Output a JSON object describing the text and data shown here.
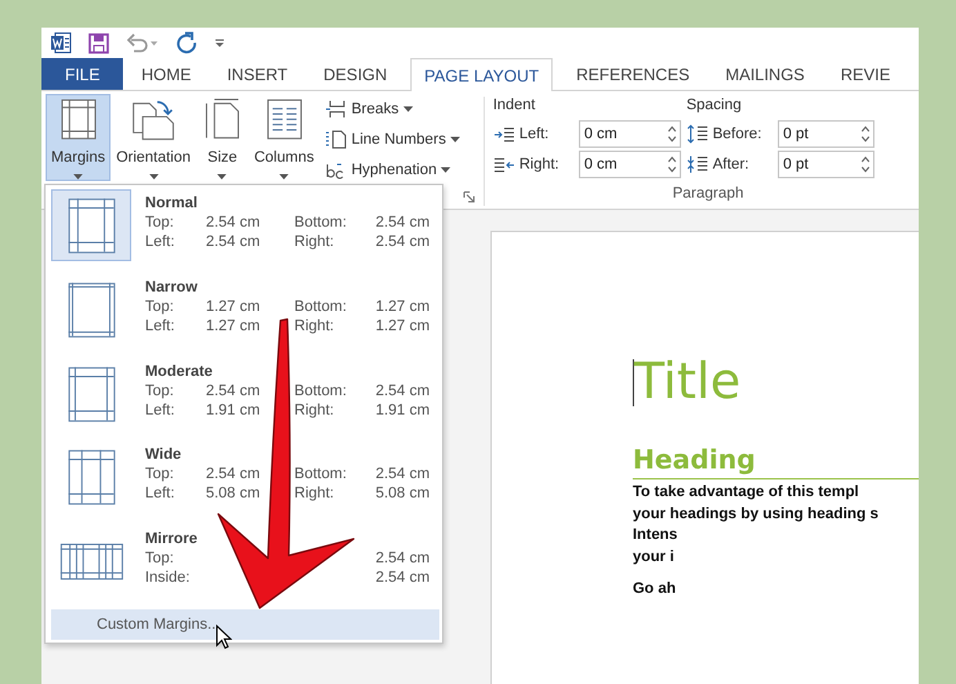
{
  "tabs": [
    {
      "label": "FILE",
      "kind": "file",
      "selected": false
    },
    {
      "label": "HOME",
      "kind": "tab",
      "selected": false
    },
    {
      "label": "INSERT",
      "kind": "tab",
      "selected": false
    },
    {
      "label": "DESIGN",
      "kind": "tab",
      "selected": false
    },
    {
      "label": "PAGE LAYOUT",
      "kind": "tab",
      "selected": true
    },
    {
      "label": "REFERENCES",
      "kind": "tab",
      "selected": false
    },
    {
      "label": "MAILINGS",
      "kind": "tab",
      "selected": false
    },
    {
      "label": "REVIE",
      "kind": "tab",
      "selected": false
    }
  ],
  "page_setup": {
    "large_buttons": [
      {
        "label": "Margins",
        "kind": "margins",
        "selected": true
      },
      {
        "label": "Orientation",
        "kind": "orientation",
        "selected": false
      },
      {
        "label": "Size",
        "kind": "size",
        "selected": false
      },
      {
        "label": "Columns",
        "kind": "columns",
        "selected": false
      }
    ],
    "small_buttons": [
      {
        "label": "Breaks",
        "kind": "breaks"
      },
      {
        "label": "Line Numbers",
        "kind": "line_numbers"
      },
      {
        "label": "Hyphenation",
        "kind": "hyphenation"
      }
    ]
  },
  "paragraph": {
    "title": "Paragraph",
    "indent": {
      "heading": "Indent",
      "fields": [
        {
          "label": "Left:",
          "value": "0 cm",
          "kind": "indent_left"
        },
        {
          "label": "Right:",
          "value": "0 cm",
          "kind": "indent_right"
        }
      ]
    },
    "spacing": {
      "heading": "Spacing",
      "fields": [
        {
          "label": "Before:",
          "value": "0 pt",
          "kind": "space_before"
        },
        {
          "label": "After:",
          "value": "0 pt",
          "kind": "space_after"
        }
      ]
    }
  },
  "margins_menu": {
    "items": [
      {
        "name": "Normal",
        "kind": "normal",
        "selected": true,
        "rows": [
          {
            "label": "Top:",
            "value": "2.54 cm",
            "label_2": "Bottom:",
            "value_2": "2.54 cm"
          },
          {
            "label": "Left:",
            "value": "2.54 cm",
            "label_2": "Right:",
            "value_2": "2.54 cm"
          }
        ]
      },
      {
        "name": "Narrow",
        "kind": "narrow",
        "selected": false,
        "rows": [
          {
            "label": "Top:",
            "value": "1.27 cm",
            "label_2": "Bottom:",
            "value_2": "1.27 cm"
          },
          {
            "label": "Left:",
            "value": "1.27 cm",
            "label_2": "Right:",
            "value_2": "1.27 cm"
          }
        ]
      },
      {
        "name": "Moderate",
        "kind": "moderate",
        "selected": false,
        "rows": [
          {
            "label": "Top:",
            "value": "2.54 cm",
            "label_2": "Bottom:",
            "value_2": "2.54 cm"
          },
          {
            "label": "Left:",
            "value": "1.91 cm",
            "label_2": "Right:",
            "value_2": "1.91 cm"
          }
        ]
      },
      {
        "name": "Wide",
        "kind": "wide",
        "selected": false,
        "rows": [
          {
            "label": "Top:",
            "value": "2.54 cm",
            "label_2": "Bottom:",
            "value_2": "2.54 cm"
          },
          {
            "label": "Left:",
            "value": "5.08 cm",
            "label_2": "Right:",
            "value_2": "5.08 cm"
          }
        ]
      },
      {
        "name": "Mirrore",
        "kind": "mirrored",
        "selected": false,
        "rows": [
          {
            "label": "Top:",
            "value_2": "2.54 cm"
          },
          {
            "label": "Inside:",
            "value_2": "2.54 cm"
          }
        ]
      }
    ],
    "footer": "Custom Margins..."
  },
  "document": {
    "title": "Title",
    "heading": "Heading",
    "lines": [
      "To take advantage of this templ",
      "your headings by using heading s",
      "Intens",
      "your i"
    ],
    "closing": "Go ah"
  }
}
